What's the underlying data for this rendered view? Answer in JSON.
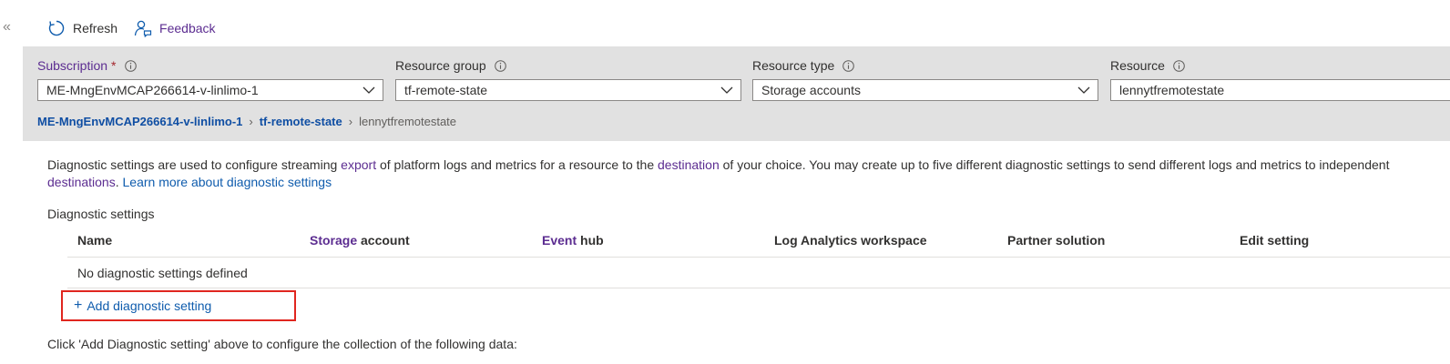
{
  "toolbar": {
    "collapse_glyph": "«",
    "refresh_label": "Refresh",
    "feedback_label": "Feedback"
  },
  "filters": {
    "subscription": {
      "label": "Subscription",
      "required_mark": "*",
      "value": "ME-MngEnvMCAP266614-v-linlimo-1"
    },
    "resource_group": {
      "label": "Resource group",
      "value": "tf-remote-state"
    },
    "resource_type": {
      "label": "Resource type",
      "value": "Storage accounts"
    },
    "resource": {
      "label": "Resource",
      "value": "lennytfremotestate"
    }
  },
  "breadcrumb": {
    "items": [
      "ME-MngEnvMCAP266614-v-linlimo-1",
      "tf-remote-state"
    ],
    "current": "lennytfremotestate"
  },
  "description": {
    "part1": "Diagnostic settings are used to configure streaming ",
    "link_export": "export",
    "part2": " of platform logs and metrics for a resource to the ",
    "link_destination": "destination",
    "part3": " of your choice. You may create up to five different diagnostic settings to send different logs and metrics to independent ",
    "link_destinations": "destinations",
    "part4": ". ",
    "learn_more": "Learn more about diagnostic settings"
  },
  "diagnostic_settings": {
    "title": "Diagnostic settings",
    "columns": {
      "name": "Name",
      "storage_highlight": "Storage",
      "storage_rest": " account",
      "event_highlight": "Event",
      "event_rest": " hub",
      "log_analytics": "Log Analytics workspace",
      "partner": "Partner solution",
      "edit": "Edit setting"
    },
    "empty_message": "No diagnostic settings defined",
    "add_button_plus": "+",
    "add_button_label": "Add diagnostic setting"
  },
  "footer_note": "Click 'Add Diagnostic setting' above to configure the collection of the following data:",
  "colors": {
    "accent_purple": "#5c2d91",
    "link_blue": "#0f5cad",
    "highlight_border": "#e0261f",
    "filter_band": "#e1e1e1"
  }
}
